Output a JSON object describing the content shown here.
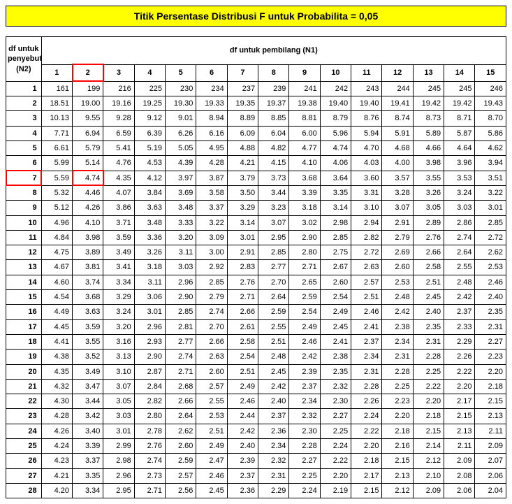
{
  "title": "Titik Persentase Distribusi F untuk Probabilita = 0,05",
  "row_header_line1": "df untuk",
  "row_header_line2": "penyebut",
  "row_header_line3": "(N2)",
  "col_header_label": "df untuk pembilang (N1)",
  "highlight": {
    "col": 2,
    "row": 7
  },
  "chart_data": {
    "type": "table",
    "title": "Titik Persentase Distribusi F untuk Probabilita = 0,05",
    "xlabel": "df untuk pembilang (N1)",
    "ylabel": "df untuk penyebut (N2)",
    "columns": [
      1,
      2,
      3,
      4,
      5,
      6,
      7,
      8,
      9,
      10,
      11,
      12,
      13,
      14,
      15
    ],
    "rows": [
      {
        "n2": 1,
        "v": [
          "161",
          "199",
          "216",
          "225",
          "230",
          "234",
          "237",
          "239",
          "241",
          "242",
          "243",
          "244",
          "245",
          "245",
          "246"
        ]
      },
      {
        "n2": 2,
        "v": [
          "18.51",
          "19.00",
          "19.16",
          "19.25",
          "19.30",
          "19.33",
          "19.35",
          "19.37",
          "19.38",
          "19.40",
          "19.40",
          "19.41",
          "19.42",
          "19.42",
          "19.43"
        ]
      },
      {
        "n2": 3,
        "v": [
          "10.13",
          "9.55",
          "9.28",
          "9.12",
          "9.01",
          "8.94",
          "8.89",
          "8.85",
          "8.81",
          "8.79",
          "8.76",
          "8.74",
          "8.73",
          "8.71",
          "8.70"
        ]
      },
      {
        "n2": 4,
        "v": [
          "7.71",
          "6.94",
          "6.59",
          "6.39",
          "6.26",
          "6.16",
          "6.09",
          "6.04",
          "6.00",
          "5.96",
          "5.94",
          "5.91",
          "5.89",
          "5.87",
          "5.86"
        ]
      },
      {
        "n2": 5,
        "v": [
          "6.61",
          "5.79",
          "5.41",
          "5.19",
          "5.05",
          "4.95",
          "4.88",
          "4.82",
          "4.77",
          "4.74",
          "4.70",
          "4.68",
          "4.66",
          "4.64",
          "4.62"
        ]
      },
      {
        "n2": 6,
        "v": [
          "5.99",
          "5.14",
          "4.76",
          "4.53",
          "4.39",
          "4.28",
          "4.21",
          "4.15",
          "4.10",
          "4.06",
          "4.03",
          "4.00",
          "3.98",
          "3.96",
          "3.94"
        ]
      },
      {
        "n2": 7,
        "v": [
          "5.59",
          "4.74",
          "4.35",
          "4.12",
          "3.97",
          "3.87",
          "3.79",
          "3.73",
          "3.68",
          "3.64",
          "3.60",
          "3.57",
          "3.55",
          "3.53",
          "3.51"
        ]
      },
      {
        "n2": 8,
        "v": [
          "5.32",
          "4.46",
          "4.07",
          "3.84",
          "3.69",
          "3.58",
          "3.50",
          "3.44",
          "3.39",
          "3.35",
          "3.31",
          "3.28",
          "3.26",
          "3.24",
          "3.22"
        ]
      },
      {
        "n2": 9,
        "v": [
          "5.12",
          "4.26",
          "3.86",
          "3.63",
          "3.48",
          "3.37",
          "3.29",
          "3.23",
          "3.18",
          "3.14",
          "3.10",
          "3.07",
          "3.05",
          "3.03",
          "3.01"
        ]
      },
      {
        "n2": 10,
        "v": [
          "4.96",
          "4.10",
          "3.71",
          "3.48",
          "3.33",
          "3.22",
          "3.14",
          "3.07",
          "3.02",
          "2.98",
          "2.94",
          "2.91",
          "2.89",
          "2.86",
          "2.85"
        ]
      },
      {
        "n2": 11,
        "v": [
          "4.84",
          "3.98",
          "3.59",
          "3.36",
          "3.20",
          "3.09",
          "3.01",
          "2.95",
          "2.90",
          "2.85",
          "2.82",
          "2.79",
          "2.76",
          "2.74",
          "2.72"
        ]
      },
      {
        "n2": 12,
        "v": [
          "4.75",
          "3.89",
          "3.49",
          "3.26",
          "3.11",
          "3.00",
          "2.91",
          "2.85",
          "2.80",
          "2.75",
          "2.72",
          "2.69",
          "2.66",
          "2.64",
          "2.62"
        ]
      },
      {
        "n2": 13,
        "v": [
          "4.67",
          "3.81",
          "3.41",
          "3.18",
          "3.03",
          "2.92",
          "2.83",
          "2.77",
          "2.71",
          "2.67",
          "2.63",
          "2.60",
          "2.58",
          "2.55",
          "2.53"
        ]
      },
      {
        "n2": 14,
        "v": [
          "4.60",
          "3.74",
          "3.34",
          "3.11",
          "2.96",
          "2.85",
          "2.76",
          "2.70",
          "2.65",
          "2.60",
          "2.57",
          "2.53",
          "2.51",
          "2.48",
          "2.46"
        ]
      },
      {
        "n2": 15,
        "v": [
          "4.54",
          "3.68",
          "3.29",
          "3.06",
          "2.90",
          "2.79",
          "2.71",
          "2.64",
          "2.59",
          "2.54",
          "2.51",
          "2.48",
          "2.45",
          "2.42",
          "2.40"
        ]
      },
      {
        "n2": 16,
        "v": [
          "4.49",
          "3.63",
          "3.24",
          "3.01",
          "2.85",
          "2.74",
          "2.66",
          "2.59",
          "2.54",
          "2.49",
          "2.46",
          "2.42",
          "2.40",
          "2.37",
          "2.35"
        ]
      },
      {
        "n2": 17,
        "v": [
          "4.45",
          "3.59",
          "3.20",
          "2.96",
          "2.81",
          "2.70",
          "2.61",
          "2.55",
          "2.49",
          "2.45",
          "2.41",
          "2.38",
          "2.35",
          "2.33",
          "2.31"
        ]
      },
      {
        "n2": 18,
        "v": [
          "4.41",
          "3.55",
          "3.16",
          "2.93",
          "2.77",
          "2.66",
          "2.58",
          "2.51",
          "2.46",
          "2.41",
          "2.37",
          "2.34",
          "2.31",
          "2.29",
          "2.27"
        ]
      },
      {
        "n2": 19,
        "v": [
          "4.38",
          "3.52",
          "3.13",
          "2.90",
          "2.74",
          "2.63",
          "2.54",
          "2.48",
          "2.42",
          "2.38",
          "2.34",
          "2.31",
          "2.28",
          "2.26",
          "2.23"
        ]
      },
      {
        "n2": 20,
        "v": [
          "4.35",
          "3.49",
          "3.10",
          "2.87",
          "2.71",
          "2.60",
          "2.51",
          "2.45",
          "2.39",
          "2.35",
          "2.31",
          "2.28",
          "2.25",
          "2.22",
          "2.20"
        ]
      },
      {
        "n2": 21,
        "v": [
          "4.32",
          "3.47",
          "3.07",
          "2.84",
          "2.68",
          "2.57",
          "2.49",
          "2.42",
          "2.37",
          "2.32",
          "2.28",
          "2.25",
          "2.22",
          "2.20",
          "2.18"
        ]
      },
      {
        "n2": 22,
        "v": [
          "4.30",
          "3.44",
          "3.05",
          "2.82",
          "2.66",
          "2.55",
          "2.46",
          "2.40",
          "2.34",
          "2.30",
          "2.26",
          "2.23",
          "2.20",
          "2.17",
          "2.15"
        ]
      },
      {
        "n2": 23,
        "v": [
          "4.28",
          "3.42",
          "3.03",
          "2.80",
          "2.64",
          "2.53",
          "2.44",
          "2.37",
          "2.32",
          "2.27",
          "2.24",
          "2.20",
          "2.18",
          "2.15",
          "2.13"
        ]
      },
      {
        "n2": 24,
        "v": [
          "4.26",
          "3.40",
          "3.01",
          "2.78",
          "2.62",
          "2.51",
          "2.42",
          "2.36",
          "2.30",
          "2.25",
          "2.22",
          "2.18",
          "2.15",
          "2.13",
          "2.11"
        ]
      },
      {
        "n2": 25,
        "v": [
          "4.24",
          "3.39",
          "2.99",
          "2.76",
          "2.60",
          "2.49",
          "2.40",
          "2.34",
          "2.28",
          "2.24",
          "2.20",
          "2.16",
          "2.14",
          "2.11",
          "2.09"
        ]
      },
      {
        "n2": 26,
        "v": [
          "4.23",
          "3.37",
          "2.98",
          "2.74",
          "2.59",
          "2.47",
          "2.39",
          "2.32",
          "2.27",
          "2.22",
          "2.18",
          "2.15",
          "2.12",
          "2.09",
          "2.07"
        ]
      },
      {
        "n2": 27,
        "v": [
          "4.21",
          "3.35",
          "2.96",
          "2.73",
          "2.57",
          "2.46",
          "2.37",
          "2.31",
          "2.25",
          "2.20",
          "2.17",
          "2.13",
          "2.10",
          "2.08",
          "2.06"
        ]
      },
      {
        "n2": 28,
        "v": [
          "4.20",
          "3.34",
          "2.95",
          "2.71",
          "2.56",
          "2.45",
          "2.36",
          "2.29",
          "2.24",
          "2.19",
          "2.15",
          "2.12",
          "2.09",
          "2.06",
          "2.04"
        ]
      }
    ]
  }
}
